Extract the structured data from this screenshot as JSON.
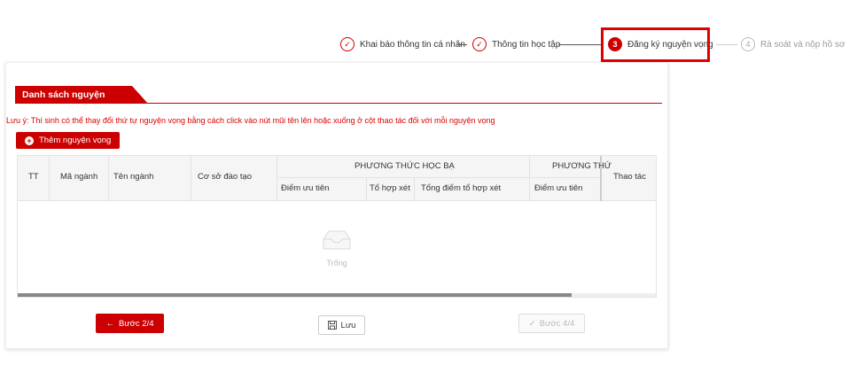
{
  "stepper": {
    "steps": [
      {
        "number": "✓",
        "label": "Khai báo thông tin cá nhân",
        "state": "done"
      },
      {
        "number": "✓",
        "label": "Thông tin học tập",
        "state": "done"
      },
      {
        "number": "3",
        "label": "Đăng ký nguyện vọng",
        "state": "active"
      },
      {
        "number": "4",
        "label": "Rà soát và nộp hồ sơ",
        "state": "todo"
      }
    ]
  },
  "section": {
    "title": "Danh sách nguyện vọng",
    "note": "Lưu ý: Thí sinh có thể thay đổi thứ tự nguyện vọng bằng cách click vào nút mũi tên lên hoặc xuống ở cột thao tác đối với mỗi nguyện vọng",
    "add_button": "Thêm nguyện vọng"
  },
  "table": {
    "col_tt": "TT",
    "col_ma_nganh": "Mã ngành",
    "col_ten_nganh": "Tên ngành",
    "col_co_so": "Cơ sở đào tạo",
    "group1": "PHƯƠNG THỨC HỌC BẠ",
    "group1_cols": [
      "Điểm ưu tiên",
      "Tổ hợp xét",
      "Tổng điểm tổ hợp xét"
    ],
    "group2": "PHƯƠNG THỨ",
    "group2_cols": [
      "Điểm ưu tiên"
    ],
    "col_thao_tac": "Thao tác",
    "empty_text": "Trống"
  },
  "footer": {
    "prev_label": "Bước 2/4",
    "save_label": "Lưu",
    "next_label": "Bước 4/4"
  },
  "colors": {
    "accent": "#cc0000",
    "highlight_frame": "#e00000"
  }
}
